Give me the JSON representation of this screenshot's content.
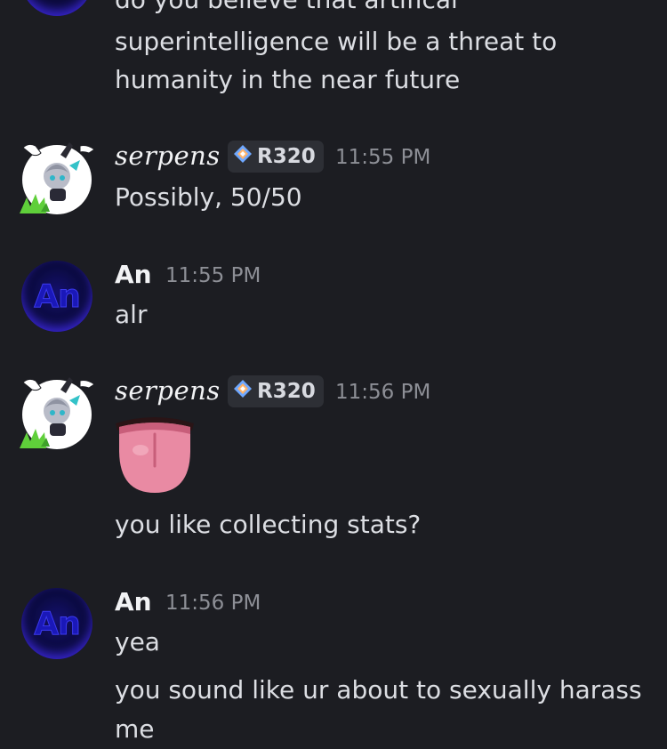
{
  "messages": [
    {
      "id": "m0",
      "continuation_lines": [
        "do you believe that artifical",
        "superintelligence will be a threat to",
        "humanity in the near future"
      ]
    },
    {
      "id": "m1",
      "author": "serpens",
      "tag": "R320",
      "time": "11:55 PM",
      "text": "Possibly, 50/50"
    },
    {
      "id": "m2",
      "author": "An",
      "time": "11:55 PM",
      "text": "alr",
      "avatar_initials": "An"
    },
    {
      "id": "m3",
      "author": "serpens",
      "tag": "R320",
      "time": "11:56 PM",
      "emoji": "tongue-emoji",
      "text": "you like collecting stats?"
    },
    {
      "id": "m4",
      "author": "An",
      "time": "11:56 PM",
      "avatar_initials": "An",
      "lines": [
        "yea",
        "you sound like ur about to sexually harass",
        "me"
      ]
    }
  ],
  "colors": {
    "background": "#1c1d22",
    "text": "#dcdee3",
    "timestamp": "#8d8f96",
    "tag_bg": "#2d2f35",
    "an_avatar": "#1a18b8"
  }
}
